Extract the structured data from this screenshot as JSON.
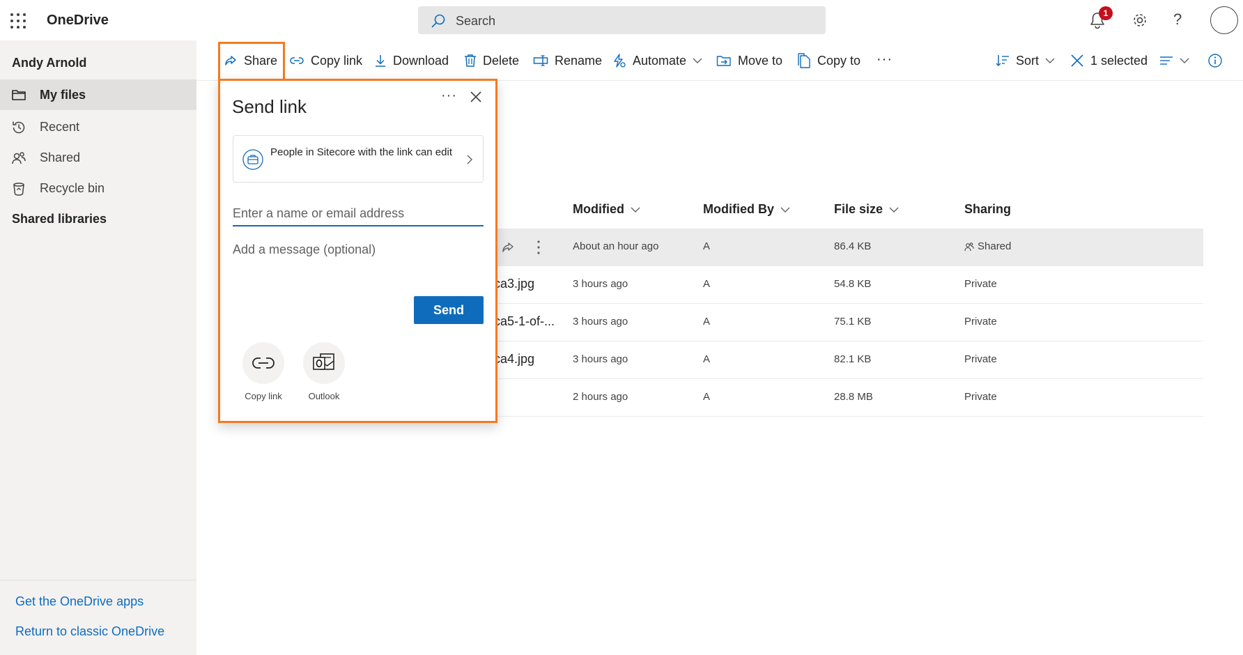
{
  "app": {
    "title": "OneDrive"
  },
  "search": {
    "placeholder": "Search"
  },
  "header": {
    "notification_count": "1",
    "help_label": "?"
  },
  "sidebar": {
    "user_name": "Andy Arnold",
    "items": [
      {
        "label": "My files",
        "icon": "folder-icon",
        "active": true
      },
      {
        "label": "Recent",
        "icon": "history-icon",
        "active": false
      },
      {
        "label": "Shared",
        "icon": "people-icon",
        "active": false
      },
      {
        "label": "Recycle bin",
        "icon": "recycle-bin-icon",
        "active": false
      }
    ],
    "section_title": "Shared libraries",
    "get_apps": "Get the OneDrive apps",
    "classic": "Return to classic OneDrive"
  },
  "toolbar": {
    "share": "Share",
    "copy_link": "Copy link",
    "download": "Download",
    "delete": "Delete",
    "rename": "Rename",
    "automate": "Automate",
    "move_to": "Move to",
    "copy_to": "Copy to",
    "more": "···",
    "sort": "Sort",
    "selected": "1 selected"
  },
  "table": {
    "headers": {
      "modified": "Modified",
      "modified_by": "Modified By",
      "file_size": "File size",
      "sharing": "Sharing"
    },
    "rows": [
      {
        "name": "",
        "modified": "About an hour ago",
        "modified_by": "A",
        "size": "86.4 KB",
        "sharing": "Shared",
        "selected": true
      },
      {
        "name": "ca3.jpg",
        "modified": "3 hours ago",
        "modified_by": "A",
        "size": "54.8 KB",
        "sharing": "Private",
        "selected": false
      },
      {
        "name": "ca5-1-of-...",
        "modified": "3 hours ago",
        "modified_by": "A",
        "size": "75.1 KB",
        "sharing": "Private",
        "selected": false
      },
      {
        "name": "ca4.jpg",
        "modified": "3 hours ago",
        "modified_by": "A",
        "size": "82.1 KB",
        "sharing": "Private",
        "selected": false
      },
      {
        "name": "",
        "modified": "2 hours ago",
        "modified_by": "A",
        "size": "28.8 MB",
        "sharing": "Private",
        "selected": false
      }
    ]
  },
  "send_panel": {
    "title": "Send link",
    "more": "···",
    "permission": "People in Sitecore with the link can edit",
    "name_placeholder": "Enter a name or email address",
    "message_placeholder": "Add a message (optional)",
    "send": "Send",
    "options": [
      {
        "label": "Copy link",
        "icon": "link-icon"
      },
      {
        "label": "Outlook",
        "icon": "outlook-icon"
      }
    ]
  },
  "colors": {
    "accent": "#0f6cbd",
    "highlight": "#f47a20",
    "badge": "#c50f1f"
  }
}
